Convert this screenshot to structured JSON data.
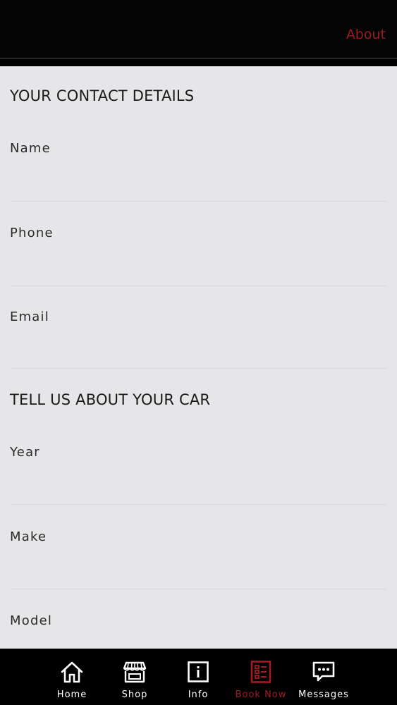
{
  "header": {
    "about_link": "About"
  },
  "contact_section": {
    "title": "YOUR CONTACT DETAILS",
    "fields": [
      {
        "label": "Name",
        "value": ""
      },
      {
        "label": "Phone",
        "value": ""
      },
      {
        "label": "Email",
        "value": ""
      }
    ]
  },
  "car_section": {
    "title": "TELL US ABOUT YOUR CAR",
    "fields": [
      {
        "label": "Year",
        "value": ""
      },
      {
        "label": "Make",
        "value": ""
      },
      {
        "label": "Model",
        "value": ""
      }
    ]
  },
  "tabbar": {
    "active_tab": "Book Now",
    "active_color": "#a01c22",
    "tabs": [
      {
        "label": "Home",
        "icon": "home-icon"
      },
      {
        "label": "Shop",
        "icon": "shop-icon"
      },
      {
        "label": "Info",
        "icon": "info-icon"
      },
      {
        "label": "Book Now",
        "icon": "booking-icon"
      },
      {
        "label": "Messages",
        "icon": "messages-icon"
      }
    ]
  },
  "colors": {
    "accent": "#9b1b1f",
    "form_background": "#e6e5e8",
    "bar_background": "#000000"
  }
}
